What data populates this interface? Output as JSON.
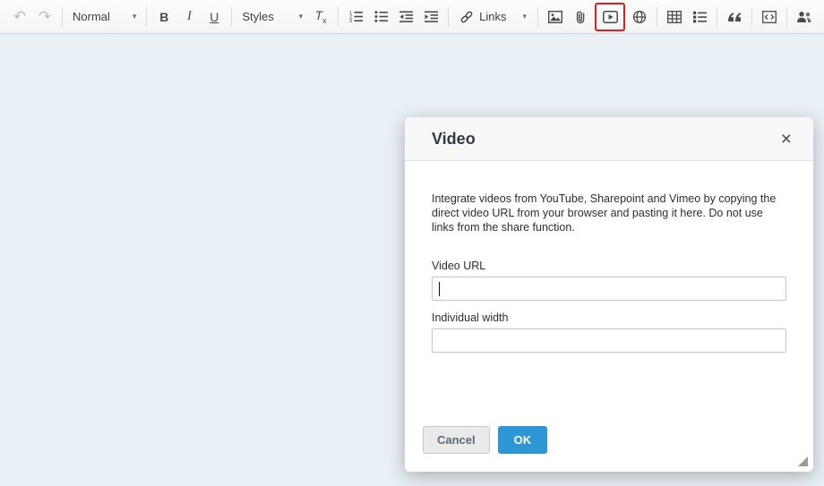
{
  "toolbar": {
    "format_value": "Normal",
    "bold": "B",
    "italic": "I",
    "underline": "U",
    "styles_value": "Styles",
    "remove_format_main": "T",
    "remove_format_sub": "x",
    "links_label": "Links",
    "chevron": "▾",
    "undo_glyph": "↶",
    "redo_glyph": "↷"
  },
  "dialog": {
    "title": "Video",
    "close": "×",
    "description": "Integrate videos from YouTube, Sharepoint and Vimeo by copying the direct video URL from your browser and pasting it here. Do not use links from the share function.",
    "fields": {
      "video_url": {
        "label": "Video URL",
        "value": "",
        "placeholder": ""
      },
      "individual_width": {
        "label": "Individual width",
        "value": "",
        "placeholder": ""
      }
    },
    "buttons": {
      "cancel": "Cancel",
      "ok": "OK"
    }
  },
  "colors": {
    "ok_button": "#2d96d4",
    "highlight_box": "#e11e1e",
    "editor_bg": "#e9f0f6",
    "toolbar_bg": "#f7f7f7"
  }
}
